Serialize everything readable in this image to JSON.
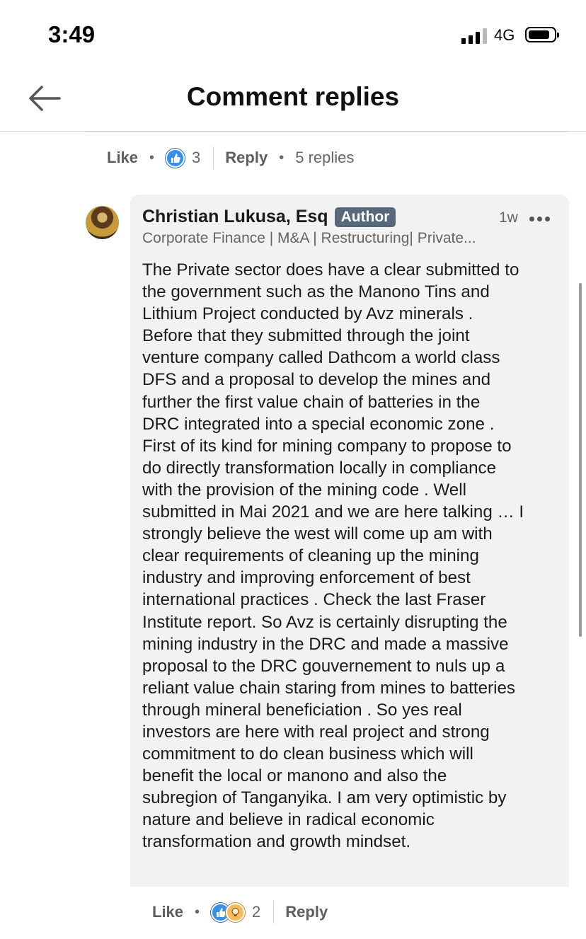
{
  "status_bar": {
    "time": "3:49",
    "network": "4G"
  },
  "header": {
    "title": "Comment replies",
    "back_icon": "arrow-left-icon"
  },
  "parent_comment_actions": {
    "like_label": "Like",
    "reaction_count": "3",
    "reply_label": "Reply",
    "replies_label": "5 replies"
  },
  "reply": {
    "author_name": "Christian Lukusa, Esq",
    "author_badge": "Author",
    "time_ago": "1w",
    "headline": "Corporate Finance | M&A | Restructuring| Private...",
    "body_lines": [
      "The Private sector does have a clear submitted to",
      "the government such as the Manono Tins and",
      "Lithium Project conducted by Avz minerals .",
      "Before that they submitted through the joint",
      "venture company called Dathcom a world class",
      "DFS and a proposal to develop the mines and",
      "further the first value chain of batteries in the",
      "DRC integrated into a special economic zone .",
      "First of its kind for mining company to propose to",
      "do directly transformation locally in compliance",
      "with the provision of the mining code . Well",
      "submitted in Mai 2021 and we are here talking … I",
      "strongly believe the west will come up am with",
      "clear requirements of cleaning up the mining",
      "industry and improving enforcement of best",
      "international practices . Check the last Fraser",
      "Institute report. So Avz is certainly disrupting the",
      "mining industry in the DRC and made a massive",
      "proposal to the DRC gouvernement to nuls up a",
      "reliant value chain staring from mines to batteries",
      "through mineral beneficiation . So yes real",
      "investors are here with real project and strong",
      "commitment to do clean business which will",
      "benefit the local or manono and also the",
      "subregion of Tanganyika. I am very optimistic by",
      "nature and believe in radical economic",
      "transformation and growth mindset."
    ],
    "actions": {
      "like_label": "Like",
      "reaction_count": "2",
      "reply_label": "Reply"
    }
  },
  "colors": {
    "like_blue": "#378fe9",
    "idea_yellow": "#f5bb5c",
    "badge_bg": "#56687a"
  }
}
